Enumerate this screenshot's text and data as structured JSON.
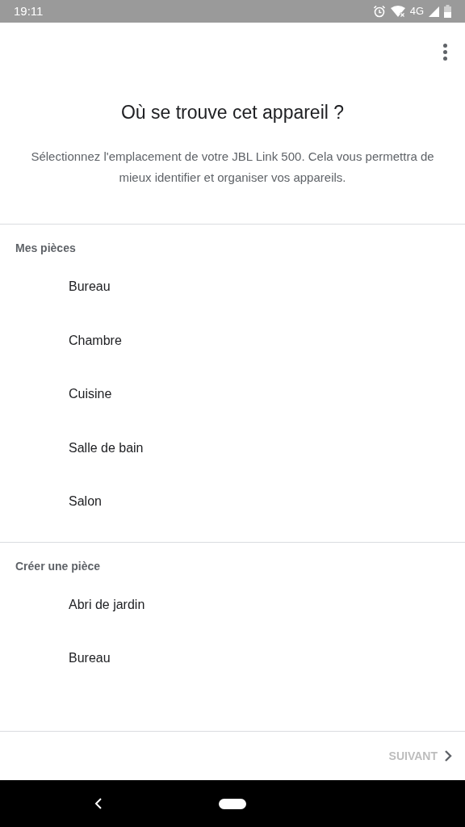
{
  "status_bar": {
    "time": "19:11",
    "network": "4G"
  },
  "title": "Où se trouve cet appareil ?",
  "description": "Sélectionnez l'emplacement de votre JBL Link 500. Cela vous permettra de mieux identifier et organiser vos appareils.",
  "sections": [
    {
      "heading": "Mes pièces",
      "items": [
        "Bureau",
        "Chambre",
        "Cuisine",
        "Salle de bain",
        "Salon"
      ]
    },
    {
      "heading": "Créer une pièce",
      "items": [
        "Abri de jardin",
        "Bureau"
      ]
    }
  ],
  "next_button": {
    "label": "SUIVANT",
    "disabled": true
  }
}
